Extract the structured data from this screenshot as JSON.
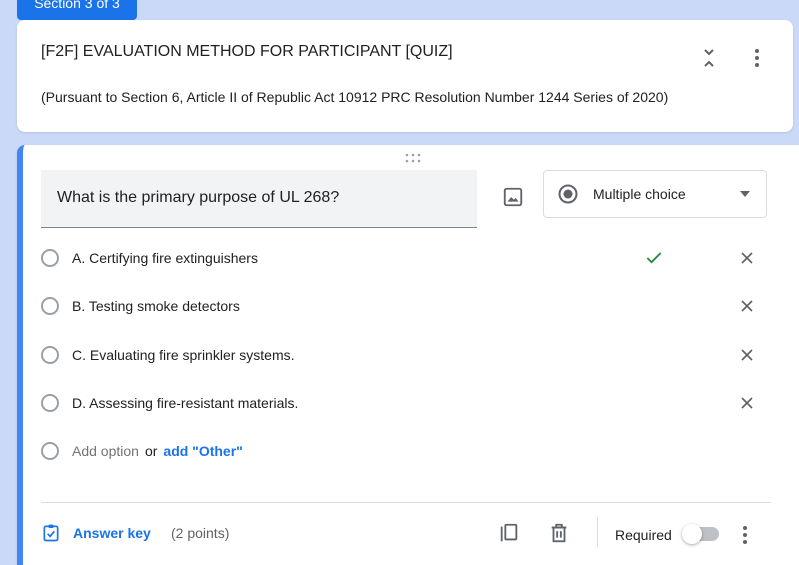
{
  "section": {
    "tab_label": "Section 3 of 3"
  },
  "header": {
    "title": "[F2F] EVALUATION METHOD FOR PARTICIPANT [QUIZ]",
    "description": "(Pursuant to Section 6, Article II of Republic Act 10912 PRC Resolution Number 1244 Series of 2020)"
  },
  "question": {
    "text": "What is the primary purpose of UL 268?",
    "type": "Multiple choice",
    "options": [
      {
        "label": "A. Certifying fire extinguishers",
        "correct": true
      },
      {
        "label": "B. Testing smoke detectors",
        "correct": false
      },
      {
        "label": "C. Evaluating fire sprinkler systems.",
        "correct": false
      },
      {
        "label": "D. Assessing fire-resistant materials.",
        "correct": false
      }
    ],
    "add_option": "Add option",
    "or": "or",
    "add_other": "add \"Other\""
  },
  "footer": {
    "answer_key": "Answer key",
    "points": "(2 points)",
    "required": "Required",
    "required_on": false
  },
  "colors": {
    "accent": "#1a73e8",
    "card_border": "#4285f4",
    "background": "#c9d9f7",
    "correct": "#1e8e3e"
  }
}
